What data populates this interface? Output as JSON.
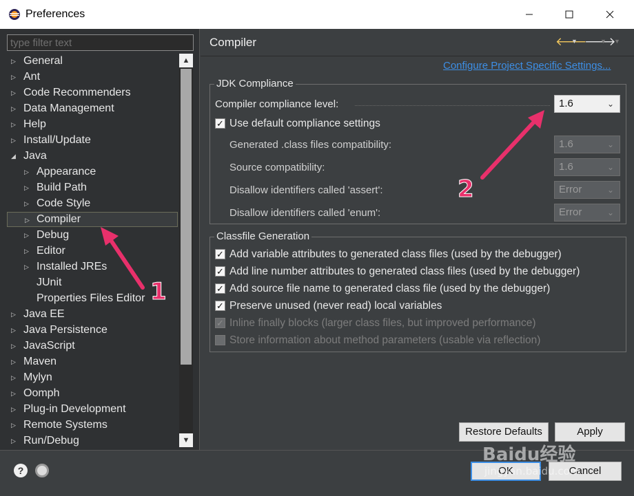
{
  "window": {
    "title": "Preferences"
  },
  "filter": {
    "placeholder": "type filter text"
  },
  "tree": {
    "items": [
      {
        "label": "General"
      },
      {
        "label": "Ant"
      },
      {
        "label": "Code Recommenders"
      },
      {
        "label": "Data Management"
      },
      {
        "label": "Help"
      },
      {
        "label": "Install/Update"
      },
      {
        "label": "Java"
      },
      {
        "label": "Appearance"
      },
      {
        "label": "Build Path"
      },
      {
        "label": "Code Style"
      },
      {
        "label": "Compiler"
      },
      {
        "label": "Debug"
      },
      {
        "label": "Editor"
      },
      {
        "label": "Installed JREs"
      },
      {
        "label": "JUnit"
      },
      {
        "label": "Properties Files Editor"
      },
      {
        "label": "Java EE"
      },
      {
        "label": "Java Persistence"
      },
      {
        "label": "JavaScript"
      },
      {
        "label": "Maven"
      },
      {
        "label": "Mylyn"
      },
      {
        "label": "Oomph"
      },
      {
        "label": "Plug-in Development"
      },
      {
        "label": "Remote Systems"
      },
      {
        "label": "Run/Debug"
      }
    ]
  },
  "page": {
    "title": "Compiler",
    "config_link": "Configure Project Specific Settings..."
  },
  "jdk": {
    "group_title": "JDK Compliance",
    "compliance_label": "Compiler compliance level:",
    "compliance_value": "1.6",
    "use_default_label": "Use default compliance settings",
    "use_default_checked": true,
    "generated_label": "Generated .class files compatibility:",
    "generated_value": "1.6",
    "source_label": "Source compatibility:",
    "source_value": "1.6",
    "assert_label": "Disallow identifiers called 'assert':",
    "assert_value": "Error",
    "enum_label": "Disallow identifiers called 'enum':",
    "enum_value": "Error"
  },
  "classfile": {
    "group_title": "Classfile Generation",
    "options": [
      {
        "label": "Add variable attributes to generated class files (used by the debugger)",
        "checked": true,
        "enabled": true
      },
      {
        "label": "Add line number attributes to generated class files (used by the debugger)",
        "checked": true,
        "enabled": true
      },
      {
        "label": "Add source file name to generated class file (used by the debugger)",
        "checked": true,
        "enabled": true
      },
      {
        "label": "Preserve unused (never read) local variables",
        "checked": true,
        "enabled": true
      },
      {
        "label": "Inline finally blocks (larger class files, but improved performance)",
        "checked": true,
        "enabled": false
      },
      {
        "label": "Store information about method parameters (usable via reflection)",
        "checked": false,
        "enabled": false
      }
    ]
  },
  "buttons": {
    "restore_defaults": "Restore Defaults",
    "apply": "Apply",
    "ok": "OK",
    "cancel": "Cancel"
  },
  "annotations": {
    "marker_1": "1",
    "marker_2": "2"
  },
  "watermark": {
    "brand": "Baidu经验",
    "url": "jingyan.baidu.com"
  },
  "icons": {
    "check": "✓",
    "chevron": "⌄",
    "expand": "▷",
    "expanded": "◢",
    "help": "?"
  },
  "colors": {
    "accent": "#3d8fe6",
    "annotation": "#e8306b",
    "back_arrow": "#f4c95d"
  }
}
